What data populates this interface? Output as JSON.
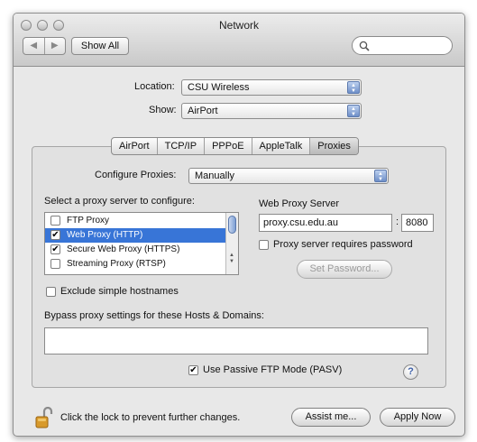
{
  "window": {
    "title": "Network"
  },
  "toolbar": {
    "back_glyph": "◀",
    "forward_glyph": "▶",
    "show_all_label": "Show All",
    "search_placeholder": ""
  },
  "location": {
    "label": "Location:",
    "value": "CSU Wireless"
  },
  "show": {
    "label": "Show:",
    "value": "AirPort"
  },
  "tabs": [
    {
      "label": "AirPort",
      "active": false
    },
    {
      "label": "TCP/IP",
      "active": false
    },
    {
      "label": "PPPoE",
      "active": false
    },
    {
      "label": "AppleTalk",
      "active": false
    },
    {
      "label": "Proxies",
      "active": true
    }
  ],
  "configure": {
    "label": "Configure Proxies:",
    "value": "Manually"
  },
  "proxy_list": {
    "label": "Select a proxy server to configure:",
    "items": [
      {
        "label": "FTP Proxy",
        "checked": false,
        "selected": false
      },
      {
        "label": "Web Proxy (HTTP)",
        "checked": true,
        "selected": true
      },
      {
        "label": "Secure Web Proxy (HTTPS)",
        "checked": true,
        "selected": false
      },
      {
        "label": "Streaming Proxy (RTSP)",
        "checked": false,
        "selected": false
      }
    ]
  },
  "server": {
    "label": "Web Proxy Server",
    "host": "proxy.csu.edu.au",
    "port_sep": ":",
    "port": "8080",
    "requires_password_label": "Proxy server requires password",
    "requires_password_checked": false,
    "set_password_label": "Set Password..."
  },
  "exclude": {
    "label": "Exclude simple hostnames",
    "checked": false
  },
  "bypass": {
    "label": "Bypass proxy settings for these Hosts & Domains:",
    "value": ""
  },
  "passive_ftp": {
    "label": "Use Passive FTP Mode (PASV)",
    "checked": true
  },
  "help": {
    "glyph": "?"
  },
  "footer": {
    "lock_text": "Click the lock to prevent further changes.",
    "assist_label": "Assist me...",
    "apply_label": "Apply Now"
  },
  "check_glyph": "✔"
}
